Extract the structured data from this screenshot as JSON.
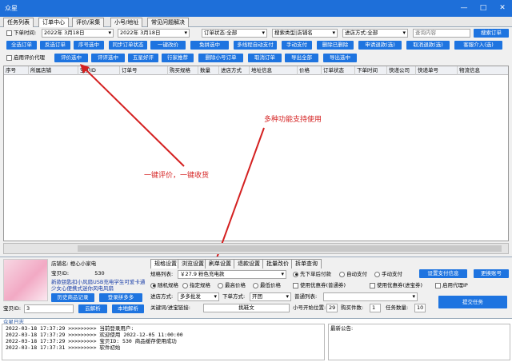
{
  "window": {
    "title": "众星",
    "minimize": "—",
    "maximize": "□",
    "close": "✕"
  },
  "tabs": [
    {
      "label": "任务列表"
    },
    {
      "label": "订单中心"
    },
    {
      "label": "评价/采集"
    },
    {
      "label": "小号/地址"
    },
    {
      "label": "常见问题解决"
    }
  ],
  "filters": {
    "order_time_label": "下单时间:",
    "date_from": "2022年 3月18日",
    "date_to": "2022年 3月18日",
    "order_status": "订单状态:全部",
    "search_type": "搜索类型|店铺名",
    "progress_method": "进店方式:全部",
    "query_placeholder": "查询内容",
    "search_button": "搜索订单"
  },
  "toolbar1": [
    {
      "label": "全选订单"
    },
    {
      "label": "反选订单"
    },
    {
      "label": "序号选中"
    },
    {
      "label": "同步订单状态"
    },
    {
      "label": "一键改价"
    },
    {
      "label": "免拼选中"
    },
    {
      "label": "多线程自动支付"
    },
    {
      "label": "手动支付"
    },
    {
      "label": "删除已删除"
    },
    {
      "label": "申请退款(选)"
    },
    {
      "label": "取消退款(选)"
    },
    {
      "label": "客服介入(选)"
    }
  ],
  "toolbar2": {
    "proxy_label": "启用评价代理",
    "buttons": [
      {
        "label": "评价选中"
      },
      {
        "label": "评评选中"
      },
      {
        "label": "五星好评"
      },
      {
        "label": "行家推荐"
      },
      {
        "label": "删除小号订单"
      },
      {
        "label": "取消订单"
      },
      {
        "label": "导出全部"
      },
      {
        "label": "导出选中"
      }
    ]
  },
  "table": {
    "columns": [
      "序号",
      "所属店铺",
      "宝贝ID",
      "订单号",
      "购买规格",
      "数量",
      "进店方式",
      "地址信息",
      "价格",
      "订单状态",
      "下单时间",
      "快递公司",
      "快递单号",
      "物流信息"
    ]
  },
  "annotations": {
    "feature": "多种功能支持使用",
    "one_click": "一键评价，一键收货"
  },
  "product": {
    "shop_label": "店铺名:",
    "shop_name": "橙心小家电",
    "item_id_label": "宝贝ID:",
    "item_id": "530",
    "desc": "新款钥匙扣小风扇USB充电学生可爱卡通少女心便携式迷你风电风扇",
    "history_button": "历史商品记录",
    "login_button": "登录拼多多",
    "sku_label": "宝贝ID:",
    "sku_value": "3",
    "cloud_parse": "云解析",
    "local_parse": "本地解析"
  },
  "settings": {
    "tabs": [
      {
        "label": "规格设置"
      },
      {
        "label": "浏览设置"
      },
      {
        "label": "刷单设置"
      },
      {
        "label": "退款设置"
      },
      {
        "label": "批量改价"
      },
      {
        "label": "拆单查询"
      }
    ],
    "spec_label": "规格列表:",
    "spec_value": "￥27.9  粉色充电款",
    "radios1": [
      {
        "label": "先下单后付款"
      },
      {
        "label": "自动支付"
      },
      {
        "label": "手动支付"
      }
    ],
    "pay_info_button": "设置支付信息",
    "switch_account_button": "更换账号",
    "radios2": [
      {
        "label": "随机规格"
      },
      {
        "label": "指定规格"
      },
      {
        "label": "最高价格"
      },
      {
        "label": "最低价格"
      }
    ],
    "checks": [
      {
        "label": "使用优惠券(普通券)"
      },
      {
        "label": "使用优惠券(进宝券)"
      },
      {
        "label": "启用代理IP"
      }
    ],
    "entry_label": "进店方式:",
    "entry_value": "多多批发",
    "order_mode_label": "下单方式:",
    "order_mode_value": "开团",
    "normal_list_label": "普通列表:",
    "keyword_label": "关键词/进宝链接:",
    "keyword_value": "挑鞋文",
    "start_label": "小号开始位置:",
    "start_value": "29",
    "buy_count_label": "购买件数:",
    "buy_count_value": "1",
    "task_count_label": "任务数量:",
    "task_count_value": "10",
    "submit_button": "提交任务"
  },
  "log": {
    "title": "众星日志",
    "lines": [
      "2022-03-18 17:37:29 >>>>>>>>> 当前登录用户: ",
      "2022-03-18 17:37:29 >>>>>>>>> 欢迎使用 2022-12-05 11:00:00",
      "2022-03-18 17:37:29 >>>>>>>>> 宝贝ID: 530 商品缓存使用成功",
      "2022-03-18 17:37:31 >>>>>>>>> 软件初始"
    ],
    "notice_label": "最新公告:"
  }
}
